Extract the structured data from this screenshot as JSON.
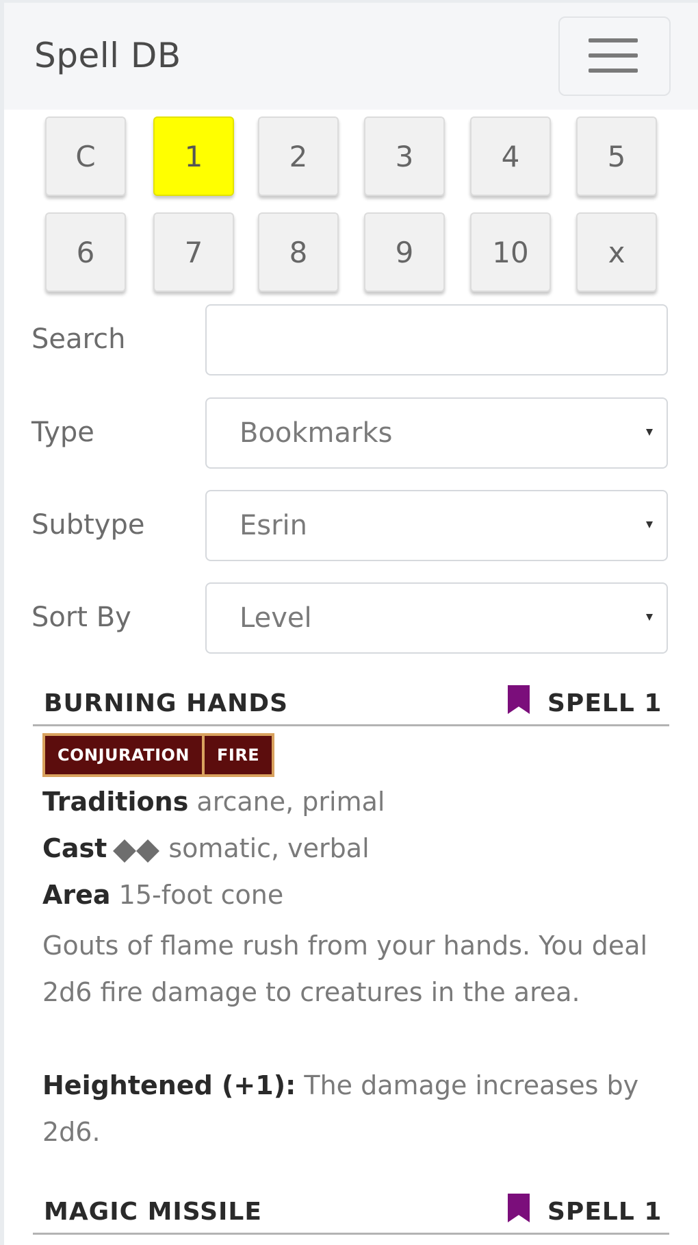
{
  "navbar": {
    "brand": "Spell DB",
    "menu_icon": "hamburger-menu-icon"
  },
  "level_buttons": [
    {
      "label": "C",
      "active": false
    },
    {
      "label": "1",
      "active": true
    },
    {
      "label": "2",
      "active": false
    },
    {
      "label": "3",
      "active": false
    },
    {
      "label": "4",
      "active": false
    },
    {
      "label": "5",
      "active": false
    },
    {
      "label": "6",
      "active": false
    },
    {
      "label": "7",
      "active": false
    },
    {
      "label": "8",
      "active": false
    },
    {
      "label": "9",
      "active": false
    },
    {
      "label": "10",
      "active": false
    },
    {
      "label": "x",
      "active": false
    }
  ],
  "filters": {
    "search": {
      "label": "Search",
      "value": ""
    },
    "type": {
      "label": "Type",
      "value": "Bookmarks"
    },
    "subtype": {
      "label": "Subtype",
      "value": "Esrin"
    },
    "sort_by": {
      "label": "Sort By",
      "value": "Level"
    }
  },
  "spells": [
    {
      "name": "BURNING HANDS",
      "level": "SPELL 1",
      "bookmarked": true,
      "traits": [
        "CONJURATION",
        "FIRE"
      ],
      "traditions_label": "Traditions",
      "traditions": "arcane, primal",
      "cast_label": "Cast",
      "cast": "somatic, verbal",
      "actions_icon": "two-action-icon",
      "area_label": "Area",
      "area": "15-foot cone",
      "description": "Gouts of flame rush from your hands. You deal 2d6 fire damage to creatures in the area.",
      "heightened_label": "Heightened (+1):",
      "heightened": "The damage increases by 2d6."
    },
    {
      "name": "MAGIC MISSILE",
      "level": "SPELL 1",
      "bookmarked": true
    }
  ],
  "colors": {
    "active_level": "#ffff00",
    "bookmark": "#7b0e7b",
    "trait_bg": "#5c0d0d",
    "trait_border": "#d9a25e"
  }
}
